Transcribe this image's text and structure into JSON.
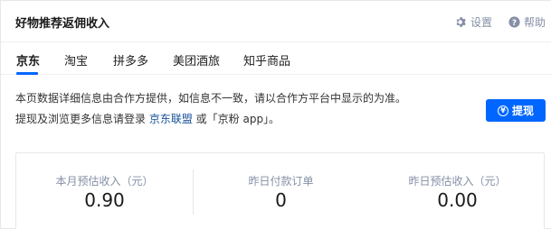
{
  "header": {
    "title": "好物推荐返佣收入",
    "settings_label": "设置",
    "help_label": "帮助"
  },
  "tabs": [
    {
      "label": "京东",
      "active": true
    },
    {
      "label": "淘宝",
      "active": false
    },
    {
      "label": "拼多多",
      "active": false
    },
    {
      "label": "美团酒旅",
      "active": false
    },
    {
      "label": "知乎商品",
      "active": false
    }
  ],
  "notice": {
    "line1": "本页数据详细信息由合作方提供，如信息不一致，请以合作方平台中显示的为准。",
    "line2_prefix": "提现及浏览更多信息请登录 ",
    "link1": "京东联盟",
    "line2_mid": " 或「京粉 app」。"
  },
  "withdraw_button": {
    "label": "提现",
    "icon": "yen-circle-icon"
  },
  "stats": [
    {
      "label": "本月预估收入（元）",
      "value": "0.90"
    },
    {
      "label": "昨日付款订单",
      "value": "0"
    },
    {
      "label": "昨日预估收入（元）",
      "value": "0.00"
    }
  ],
  "colors": {
    "accent": "#0066ff",
    "link": "#175199",
    "muted": "#8590a6"
  }
}
